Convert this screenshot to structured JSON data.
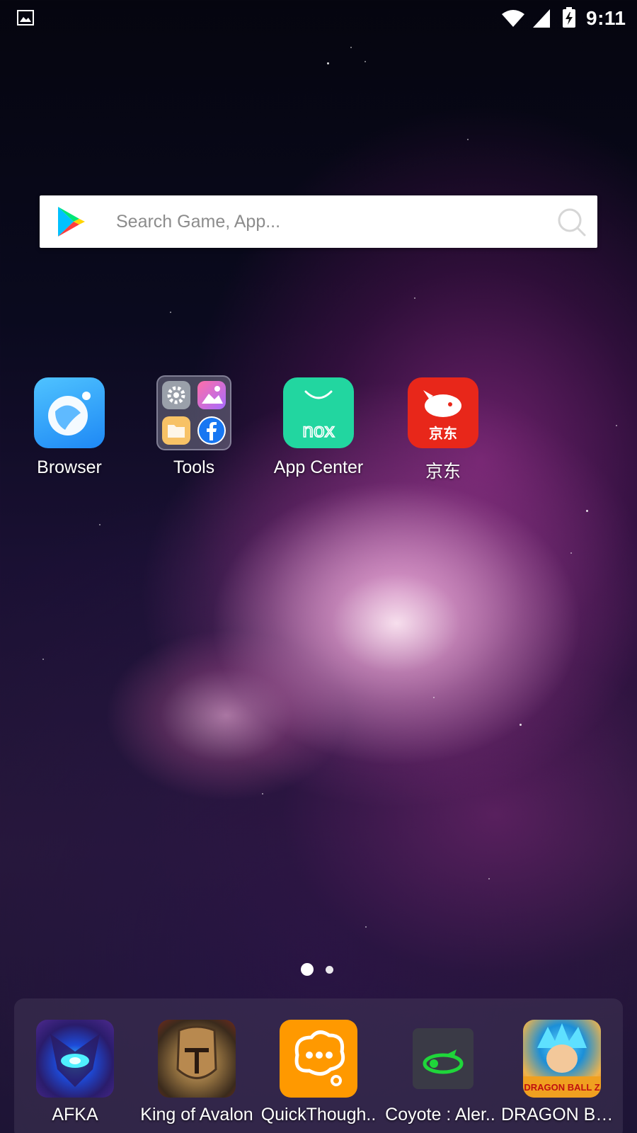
{
  "status_bar": {
    "time": "9:11",
    "icons": [
      "gallery-notification-icon",
      "wifi-icon",
      "cell-signal-icon",
      "battery-charging-icon"
    ]
  },
  "search": {
    "placeholder": "Search Game, App...",
    "value": "",
    "logo": "play-store-icon",
    "icon": "search-icon"
  },
  "desktop": {
    "apps": [
      {
        "label": "Browser",
        "icon": "browser-icon"
      },
      {
        "label": "Tools",
        "icon": "tools-folder-icon"
      },
      {
        "label": "App Center",
        "icon": "app-center-icon",
        "icon_text": "nox"
      },
      {
        "label": "京东",
        "icon": "jd-icon",
        "icon_text": "京东"
      }
    ]
  },
  "pages": {
    "count": 2,
    "current": 1
  },
  "dock": {
    "apps": [
      {
        "label": "AFKA",
        "icon": "afka-icon"
      },
      {
        "label": "King of Avalon",
        "icon": "king-of-avalon-icon"
      },
      {
        "label": "QuickThough..",
        "icon": "quickthought-icon"
      },
      {
        "label": "Coyote : Aler..",
        "icon": "coyote-icon"
      },
      {
        "label": "DRAGON BAL..",
        "icon": "dragon-ball-icon",
        "icon_text": "DRAGON BALL Z"
      }
    ]
  },
  "colors": {
    "app_center": "#22d6a0",
    "jd": "#e8271a",
    "browser": "#1e88f5",
    "quickthought": "#ff9900"
  }
}
